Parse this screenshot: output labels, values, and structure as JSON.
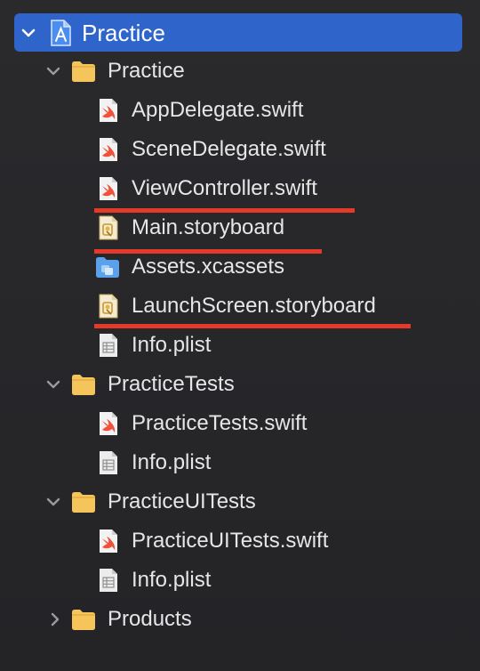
{
  "navigator": {
    "rows": [
      {
        "label": "Practice",
        "icon": "xcode-project-icon",
        "chevron": "expanded"
      },
      {
        "label": "Practice",
        "icon": "folder-icon",
        "chevron": "expanded"
      },
      {
        "label": "AppDelegate.swift",
        "icon": "swift-file-icon"
      },
      {
        "label": "SceneDelegate.swift",
        "icon": "swift-file-icon"
      },
      {
        "label": "ViewController.swift",
        "icon": "swift-file-icon"
      },
      {
        "label": "Main.storyboard",
        "icon": "storyboard-file-icon"
      },
      {
        "label": "Assets.xcassets",
        "icon": "asset-catalog-icon"
      },
      {
        "label": "LaunchScreen.storyboard",
        "icon": "storyboard-file-icon"
      },
      {
        "label": "Info.plist",
        "icon": "plist-file-icon"
      },
      {
        "label": "PracticeTests",
        "icon": "folder-icon",
        "chevron": "expanded"
      },
      {
        "label": "PracticeTests.swift",
        "icon": "swift-file-icon"
      },
      {
        "label": "Info.plist",
        "icon": "plist-file-icon"
      },
      {
        "label": "PracticeUITests",
        "icon": "folder-icon",
        "chevron": "expanded"
      },
      {
        "label": "PracticeUITests.swift",
        "icon": "swift-file-icon"
      },
      {
        "label": "Info.plist",
        "icon": "plist-file-icon"
      },
      {
        "label": "Products",
        "icon": "folder-icon",
        "chevron": "collapsed"
      }
    ]
  },
  "colors": {
    "selection": "#2f65ca",
    "annotation_underline": "#e53a2a",
    "folder": "#f5c45b",
    "swift": "#f0513b"
  }
}
